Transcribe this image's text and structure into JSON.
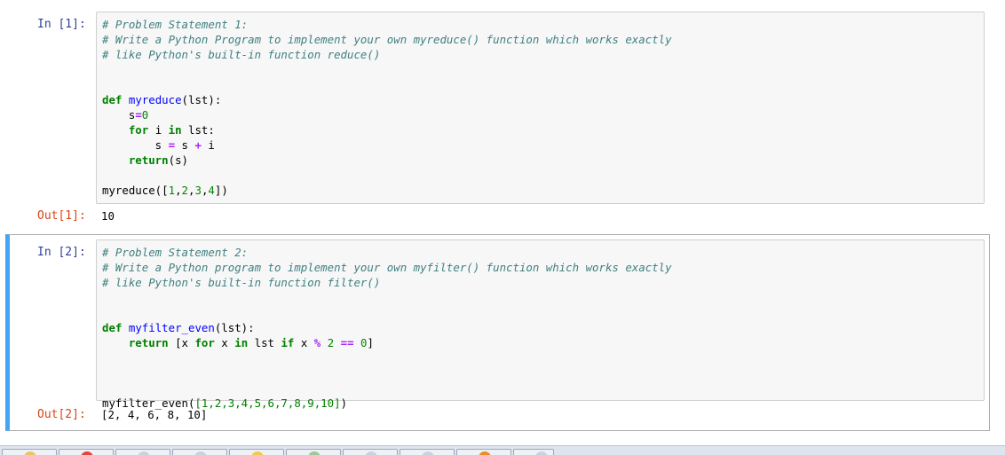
{
  "cells": [
    {
      "in_prompt": "In [1]:",
      "code": [
        "# Problem Statement 1:",
        "# Write a Python Program to implement your own myreduce() function which works exactly",
        "# like Python's built-in function reduce()",
        "",
        "",
        "def myreduce(lst):",
        "    s=0",
        "    for i in lst:",
        "        s = s + i",
        "    return(s)",
        "",
        "myreduce([1,2,3,4])"
      ],
      "out_prompt": "Out[1]:",
      "output": "10"
    },
    {
      "in_prompt": "In [2]:",
      "code": [
        "# Problem Statement 2:",
        "# Write a Python program to implement your own myfilter() function which works exactly",
        "# like Python's built-in function filter()",
        "",
        "",
        "def myfilter_even(lst):",
        "    return [x for x in lst if x % 2 == 0]",
        "",
        "",
        "",
        "myfilter_even([1,2,3,4,5,6,7,8,9,10])"
      ],
      "out_prompt": "Out[2]:",
      "output": "[2, 4, 6, 8, 10]"
    }
  ],
  "colors": {
    "selected_border": "#42a5f5",
    "in_prompt": "#303f9f",
    "out_prompt": "#d84315",
    "comment": "#408080",
    "keyword": "#008000",
    "function_name": "#0000ff"
  },
  "taskbar_icons": [
    "explorer-icon",
    "chrome-icon",
    "app-icon",
    "app-icon",
    "folder-icon",
    "notepad-icon",
    "app-icon",
    "app-icon",
    "vlc-icon",
    "app-icon"
  ]
}
